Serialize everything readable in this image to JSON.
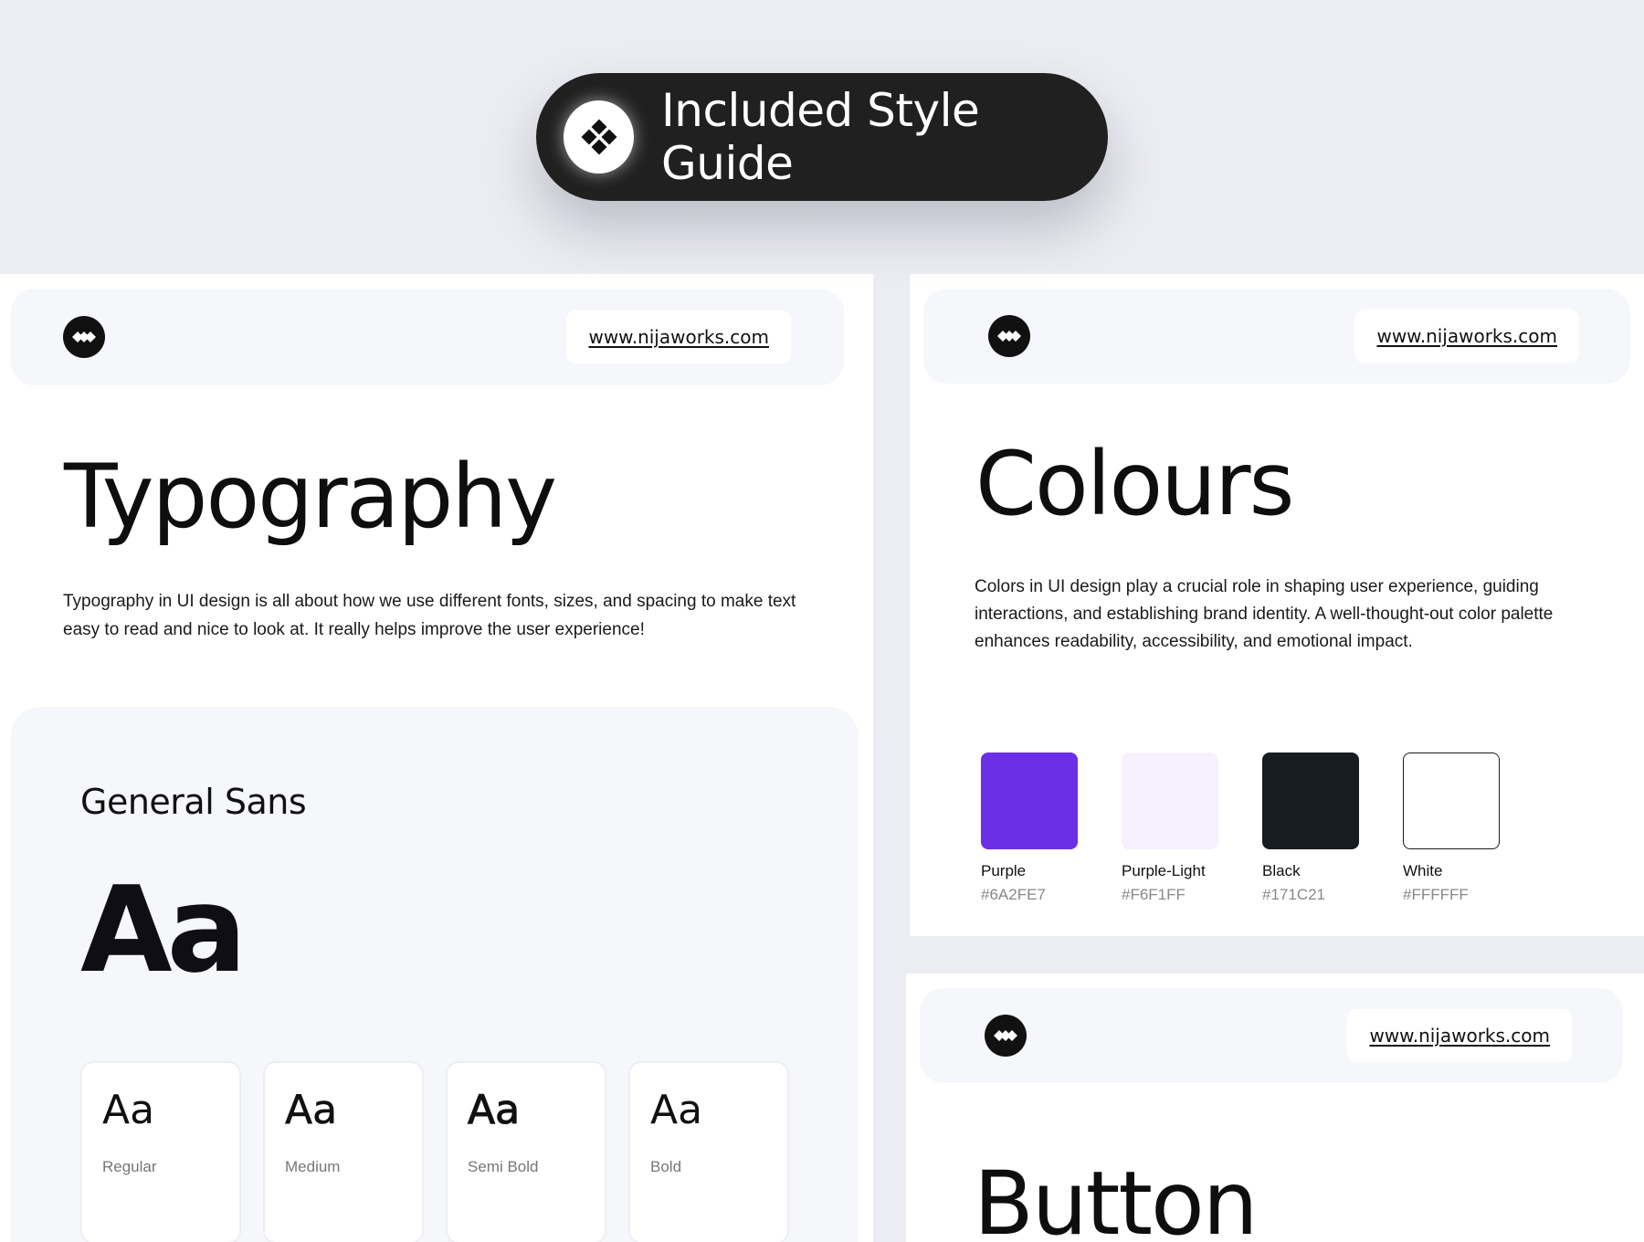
{
  "hero": {
    "title": "Included Style Guide",
    "icon": "diamond-grid-icon"
  },
  "header": {
    "url": "www.nijaworks.com",
    "logo_icon": "brand-logo-icon"
  },
  "typography": {
    "title": "Typography",
    "description": "Typography in UI design is all about how we use different fonts, sizes, and spacing to make text easy to read and nice to look at. It really helps improve the user experience!",
    "font_name": "General Sans",
    "sample": "Aa",
    "weights": [
      {
        "sample": "Aa",
        "label": "Regular"
      },
      {
        "sample": "Aa",
        "label": "Medium"
      },
      {
        "sample": "Aa",
        "label": "Semi Bold"
      },
      {
        "sample": "Aa",
        "label": "Bold"
      }
    ]
  },
  "colours": {
    "title": "Colours",
    "description": "Colors in UI design play a crucial role in shaping user experience, guiding interactions, and establishing brand identity. A well-thought-out color palette enhances readability, accessibility, and emotional impact.",
    "swatches": [
      {
        "name": "Purple",
        "hex": "#6A2FE7"
      },
      {
        "name": "Purple-Light",
        "hex": "#F6F1FF"
      },
      {
        "name": "Black",
        "hex": "#171C21"
      },
      {
        "name": "White",
        "hex": "#FFFFFF"
      }
    ]
  },
  "button_section": {
    "title": "Button"
  }
}
